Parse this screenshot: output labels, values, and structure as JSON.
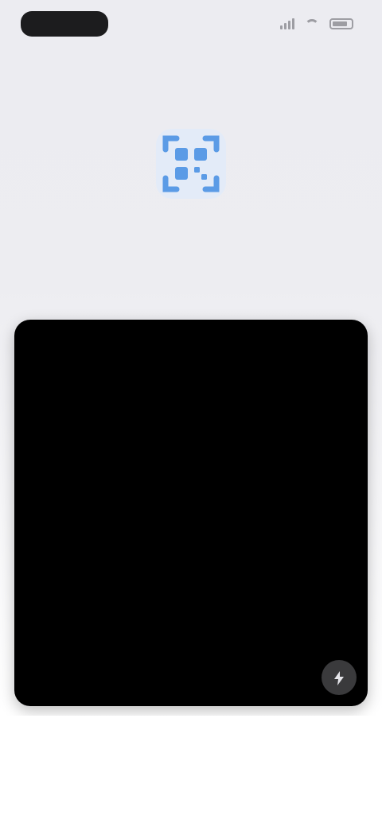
{
  "status_bar": {
    "time": "",
    "signal_icon": "signal-bars-icon",
    "wifi_icon": "wifi-icon",
    "battery_icon": "battery-icon"
  },
  "header": {
    "help_label": "",
    "icon": "qr-code-icon",
    "icon_color": "#4a90e2",
    "title_line1": "",
    "title_line2": ""
  },
  "viewfinder": {
    "flash_icon": "flashlight-icon",
    "background_color": "#000000"
  }
}
